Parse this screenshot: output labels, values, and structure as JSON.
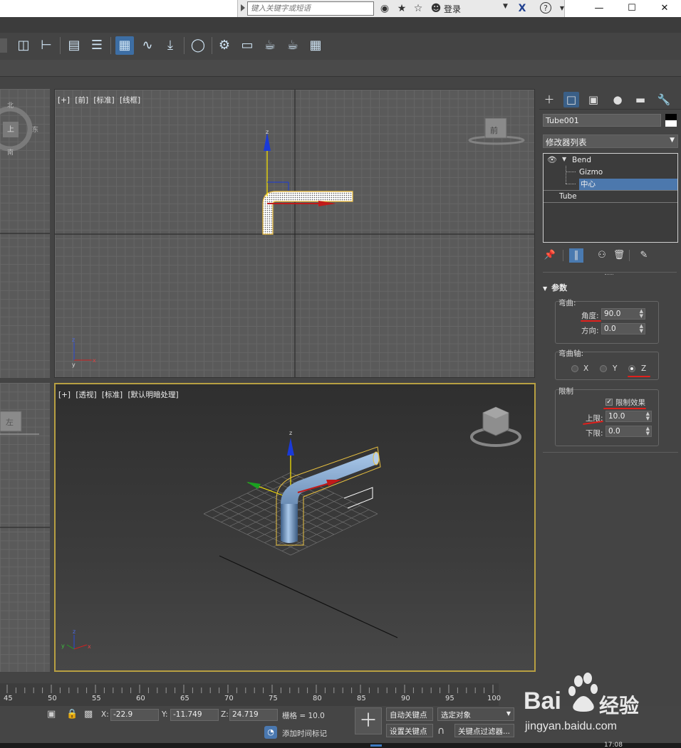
{
  "titlebar": {
    "search_placeholder": "键入关键字或短语",
    "login": "登录",
    "help_icon": "?",
    "window_controls": [
      "—",
      "☐",
      "✕"
    ]
  },
  "toolbar": {
    "icons": [
      "mirror-icon",
      "align-icon",
      "layer-explorer-icon",
      "layers-icon",
      "toggle-scene-explorer-icon",
      "curve-editor-icon",
      "schematic-icon",
      "render-setup-icon",
      "material-editor-icon",
      "render-frame-icon",
      "render-icon",
      "render-iterative-icon",
      "render-in-cloud-icon"
    ]
  },
  "viewports": {
    "front": {
      "label": [
        "[+]",
        "[前]",
        "[标准]",
        "[线框]"
      ],
      "viewcube": "前"
    },
    "top": {
      "compass": [
        "北",
        "上",
        "东",
        "南"
      ]
    },
    "left": {
      "viewcube": "左"
    },
    "perspective": {
      "label": [
        "[+]",
        "[透视]",
        "[标准]",
        "[默认明暗处理]"
      ]
    }
  },
  "panel": {
    "object_name": "Tube001",
    "modifier_list": "修改器列表",
    "stack": [
      {
        "label": "Bend",
        "level": 0
      },
      {
        "label": "Gizmo",
        "level": 1
      },
      {
        "label": "中心",
        "level": 1,
        "selected": true
      },
      {
        "label": "Tube",
        "level": 0
      }
    ],
    "rollout_title": "参数",
    "bend_group": "弯曲:",
    "angle_label": "角度:",
    "angle_value": "90.0",
    "direction_label": "方向:",
    "direction_value": "0.0",
    "axis_group": "弯曲轴:",
    "axes": [
      "X",
      "Y",
      "Z"
    ],
    "axis_selected": "Z",
    "limit_group": "限制",
    "limit_effect_label": "限制效果",
    "limit_effect_checked": true,
    "upper_label": "上限:",
    "upper_value": "10.0",
    "lower_label": "下限:",
    "lower_value": "0.0"
  },
  "timeline": {
    "ticks": [
      "45",
      "50",
      "55",
      "60",
      "65",
      "70",
      "75",
      "80",
      "85",
      "90",
      "95",
      "100"
    ]
  },
  "status": {
    "x_label": "X:",
    "x_value": "-22.9",
    "y_label": "Y:",
    "y_value": "-11.749",
    "z_label": "Z:",
    "z_value": "24.719",
    "grid_label": "栅格 = 10.0",
    "add_time_tag": "添加时间标记",
    "auto_key": "自动关键点",
    "set_key": "设置关键点",
    "selected_object": "选定对象",
    "key_filters": "关键点过滤器...",
    "clock": "17:08"
  },
  "watermark": {
    "brand": "Bai",
    "brand_cn": "经验",
    "url": "jingyan.baidu.com"
  },
  "colors": {
    "accent": "#3d6ea4",
    "selection_yellow": "#b8a042",
    "annotation_red": "#e0201c",
    "tube_blue": "#7fa7d0"
  }
}
